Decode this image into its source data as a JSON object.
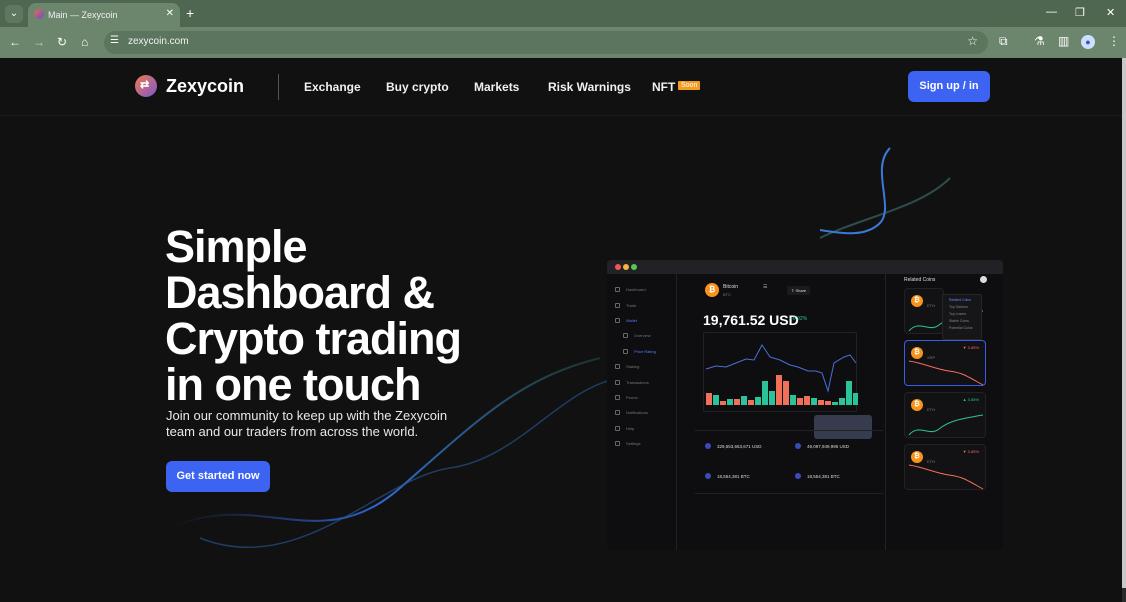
{
  "browser": {
    "tab_title": "Main — Zexycoin",
    "url": "zexycoin.com",
    "icons": {
      "tab_list": "chevron-down-icon",
      "close_tab": "close-icon",
      "new_tab": "plus-icon",
      "back": "arrow-left-icon",
      "forward": "arrow-right-icon",
      "reload": "reload-icon",
      "home": "home-icon",
      "site_info": "tune-icon",
      "bookmark": "star-icon",
      "extensions": "puzzle-icon",
      "labs": "flask-icon",
      "side_panel": "side-panel-icon",
      "profile": "profile-icon",
      "menu": "kebab-icon"
    },
    "glyphs": {
      "tab_list": "⌄",
      "close_tab": "✕",
      "new_tab": "+",
      "minimize": "—",
      "restore": "❐",
      "close": "✕",
      "back": "←",
      "forward": "→",
      "reload": "↻",
      "home": "⌂",
      "site_info": "☰",
      "bookmark": "☆",
      "extensions": "⧉",
      "labs": "⚗",
      "side_panel": "▥",
      "profile": "●",
      "menu": "⋮"
    }
  },
  "site": {
    "brand": "Zexycoin",
    "logo_glyph": "⇄",
    "nav": [
      {
        "label": "Exchange"
      },
      {
        "label": "Buy crypto"
      },
      {
        "label": "Markets"
      },
      {
        "label": "Risk Warnings"
      },
      {
        "label": "NFT"
      }
    ],
    "nft_badge": "Soon",
    "signup_label": "Sign up / in",
    "accent_color": "#3c63f2",
    "badge_color": "#f39c1e"
  },
  "hero": {
    "title_lines": [
      "Simple",
      "Dashboard &",
      "Crypto trading",
      "in one touch"
    ],
    "subtitle": "Join our community to keep up with the Zexycoin team and our traders from across the world.",
    "cta_label": "Get started now"
  },
  "dashboard": {
    "sidebar": [
      {
        "label": "Dashboard"
      },
      {
        "label": "Trade"
      },
      {
        "label": "Wallet"
      },
      {
        "label": "Overview"
      },
      {
        "label": "Price Rating"
      },
      {
        "label": "Staking"
      },
      {
        "label": "Transactions"
      },
      {
        "label": "Promo"
      },
      {
        "label": "Notifications"
      },
      {
        "label": "Help"
      },
      {
        "label": "Settings"
      }
    ],
    "coin_name": "Bitcoin",
    "coin_symbol": "BTC",
    "share_label": "Share",
    "price": "19,761.52 USD",
    "change": "+0.92%",
    "stats": [
      {
        "value": "329,553,663,671 USD"
      },
      {
        "value": "49,097,949,995 USD"
      },
      {
        "value": "18,554,381 BTC"
      },
      {
        "value": "18,554,381 BTC"
      }
    ],
    "related_title": "Related Coins",
    "related_menu": [
      "Related Coins",
      "Top Gainers",
      "Top Losers",
      "Stable Coins",
      "Potential Coins"
    ],
    "related_cards": [
      {
        "symbol": "ETH",
        "change": "",
        "trend": "up"
      },
      {
        "symbol": "XRP",
        "change": "3.85%",
        "trend": "down"
      },
      {
        "symbol": "ETH",
        "change": "3.85%",
        "trend": "up"
      },
      {
        "symbol": "ETH",
        "change": "3.85%",
        "trend": "down"
      }
    ],
    "colors": {
      "up": "#2bc49a",
      "down": "#f0705a"
    }
  }
}
